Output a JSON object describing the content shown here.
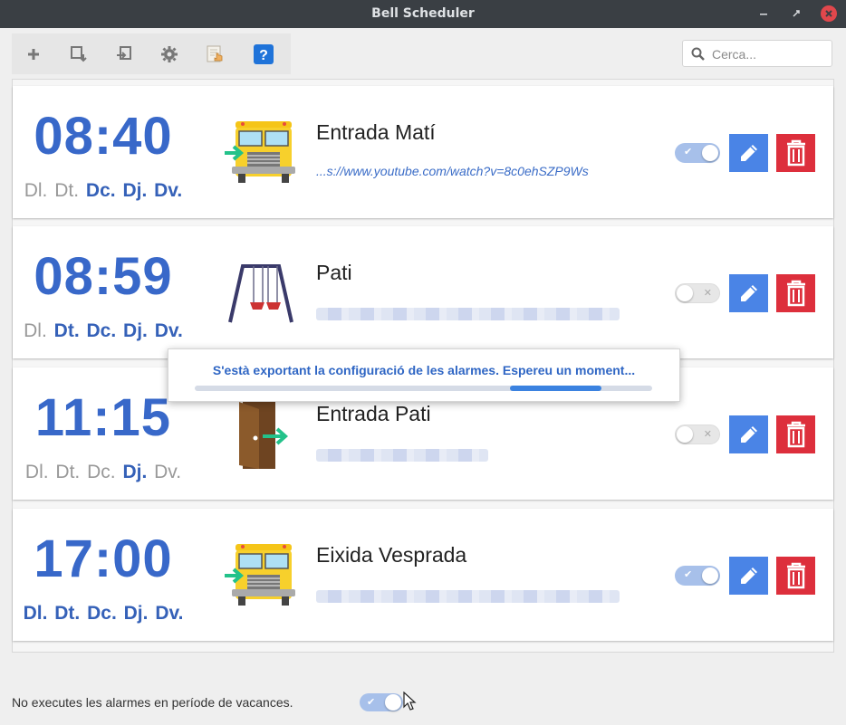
{
  "window": {
    "title": "Bell Scheduler"
  },
  "toolbar": {
    "buttons": [
      "add-icon",
      "import-icon",
      "export-icon",
      "settings-icon",
      "hand-document-icon",
      "help-icon"
    ],
    "help_label": "?"
  },
  "search": {
    "placeholder": "Cerca...",
    "value": ""
  },
  "alarms": [
    {
      "time": "08:40",
      "days": [
        {
          "label": "Dl.",
          "active": false
        },
        {
          "label": "Dt.",
          "active": false
        },
        {
          "label": "Dc.",
          "active": true
        },
        {
          "label": "Dj.",
          "active": true
        },
        {
          "label": "Dv.",
          "active": true
        }
      ],
      "icon": "school-bus-enter-icon",
      "name": "Entrada Matí",
      "sound": "...s://www.youtube.com/watch?v=8c0ehSZP9Ws",
      "enabled": true
    },
    {
      "time": "08:59",
      "days": [
        {
          "label": "Dl.",
          "active": false
        },
        {
          "label": "Dt.",
          "active": true
        },
        {
          "label": "Dc.",
          "active": true
        },
        {
          "label": "Dj.",
          "active": true
        },
        {
          "label": "Dv.",
          "active": true
        }
      ],
      "icon": "swing-icon",
      "name": "Pati",
      "sound": "",
      "enabled": false
    },
    {
      "time": "11:15",
      "days": [
        {
          "label": "Dl.",
          "active": false
        },
        {
          "label": "Dt.",
          "active": false
        },
        {
          "label": "Dc.",
          "active": false
        },
        {
          "label": "Dj.",
          "active": true
        },
        {
          "label": "Dv.",
          "active": false
        }
      ],
      "icon": "door-enter-icon",
      "name": "Entrada Pati",
      "sound": "",
      "enabled": false
    },
    {
      "time": "17:00",
      "days": [
        {
          "label": "Dl.",
          "active": true
        },
        {
          "label": "Dt.",
          "active": true
        },
        {
          "label": "Dc.",
          "active": true
        },
        {
          "label": "Dj.",
          "active": true
        },
        {
          "label": "Dv.",
          "active": true
        }
      ],
      "icon": "school-bus-enter-icon",
      "name": "Eixida Vesprada",
      "sound": "",
      "enabled": true
    }
  ],
  "progress": {
    "message": "S'està exportant la configuració de les alarmes. Espereu un moment...",
    "indicator_start": 0.69,
    "indicator_end": 0.89
  },
  "footer": {
    "vacation_label": "No executes les alarmes en període de vacances.",
    "vacation_enabled": true
  },
  "colors": {
    "accent": "#3868c9",
    "edit_button": "#4a84e6",
    "delete_button": "#dd2f3c",
    "toggle_on": "#a7c0ea",
    "titlebar": "#3a3f44"
  }
}
